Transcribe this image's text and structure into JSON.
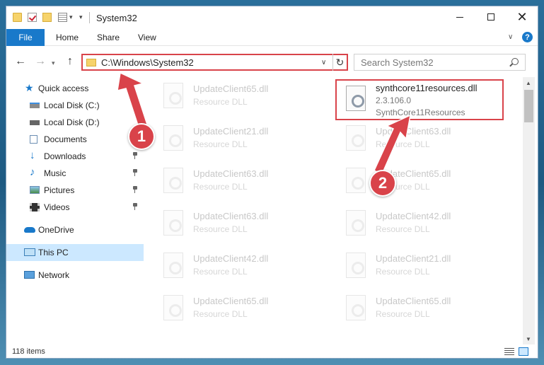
{
  "window": {
    "title": "System32",
    "controls": {
      "minimize": "—",
      "maximize": "□",
      "close": "✕"
    }
  },
  "ribbon": {
    "tabs": [
      "File",
      "Home",
      "Share",
      "View"
    ],
    "help": "?"
  },
  "address": {
    "path": "C:\\Windows\\System32",
    "search_placeholder": "Search System32"
  },
  "sidebar": {
    "items": [
      {
        "label": "Quick access",
        "icon": "star-icon"
      },
      {
        "label": "Local Disk (C:)",
        "icon": "drive-icon"
      },
      {
        "label": "Local Disk (D:)",
        "icon": "drive-icon"
      },
      {
        "label": "Documents",
        "icon": "documents-icon"
      },
      {
        "label": "Downloads",
        "icon": "download-icon"
      },
      {
        "label": "Music",
        "icon": "music-icon"
      },
      {
        "label": "Pictures",
        "icon": "pictures-icon"
      },
      {
        "label": "Videos",
        "icon": "videos-icon"
      },
      {
        "label": "OneDrive",
        "icon": "cloud-icon"
      },
      {
        "label": "This PC",
        "icon": "computer-icon"
      },
      {
        "label": "Network",
        "icon": "network-icon"
      }
    ]
  },
  "files": {
    "highlighted": {
      "name": "synthcore11resources.dll",
      "version": "2.3.106.0",
      "description": "SynthCore11Resources"
    },
    "left_column": [
      {
        "name": "UpdateClient65.dll",
        "type": "Resource DLL"
      },
      {
        "name": "UpdateClient21.dll",
        "type": "Resource DLL"
      },
      {
        "name": "UpdateClient63.dll",
        "type": "Resource DLL"
      },
      {
        "name": "UpdateClient63.dll",
        "type": "Resource DLL"
      },
      {
        "name": "UpdateClient42.dll",
        "type": "Resource DLL"
      },
      {
        "name": "UpdateClient65.dll",
        "type": "Resource DLL"
      }
    ],
    "right_column": [
      {
        "name": "UpdateClient63.dll",
        "type": "Resource DLL"
      },
      {
        "name": "UpdateClient65.dll",
        "type": "Resource DLL"
      },
      {
        "name": "UpdateClient42.dll",
        "type": "Resource DLL"
      },
      {
        "name": "UpdateClient21.dll",
        "type": "Resource DLL"
      },
      {
        "name": "UpdateClient65.dll",
        "type": "Resource DLL"
      }
    ]
  },
  "status": {
    "item_count": "118 items"
  },
  "annotations": {
    "marker1": "1",
    "marker2": "2",
    "color": "#d9434a"
  }
}
